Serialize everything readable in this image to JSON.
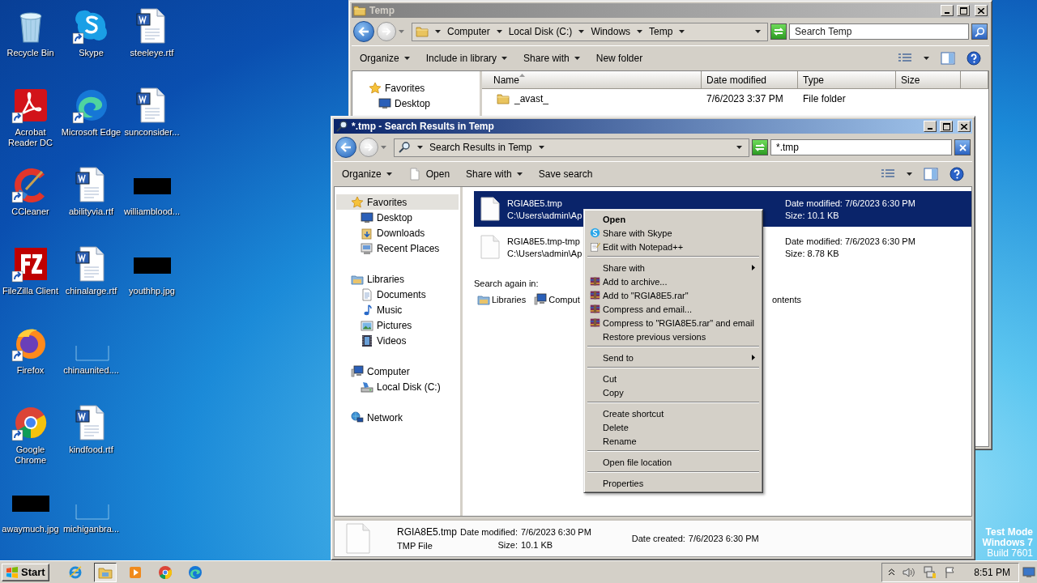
{
  "desktop": {
    "icons": [
      {
        "label": "Recycle Bin",
        "kind": "recycle",
        "shortcut": false
      },
      {
        "label": "Acrobat Reader DC",
        "kind": "acrobat",
        "shortcut": true
      },
      {
        "label": "CCleaner",
        "kind": "ccleaner",
        "shortcut": true
      },
      {
        "label": "FileZilla Client",
        "kind": "filezilla",
        "shortcut": true
      },
      {
        "label": "Firefox",
        "kind": "firefox",
        "shortcut": true
      },
      {
        "label": "Google Chrome",
        "kind": "chrome",
        "shortcut": true
      },
      {
        "label": "awaymuch.jpg",
        "kind": "dark",
        "shortcut": false
      },
      {
        "label": "Skype",
        "kind": "skype",
        "shortcut": true
      },
      {
        "label": "Microsoft Edge",
        "kind": "edge",
        "shortcut": true
      },
      {
        "label": "abilityvia.rtf",
        "kind": "word",
        "shortcut": false
      },
      {
        "label": "chinalarge.rtf",
        "kind": "word",
        "shortcut": false
      },
      {
        "label": "chinaunited....",
        "kind": "blank",
        "shortcut": false
      },
      {
        "label": "kindfood.rtf",
        "kind": "word",
        "shortcut": false
      },
      {
        "label": "michiganbra...",
        "kind": "blank",
        "shortcut": false
      },
      {
        "label": "steeleye.rtf",
        "kind": "word",
        "shortcut": false
      },
      {
        "label": "sunconsider...",
        "kind": "word",
        "shortcut": false
      },
      {
        "label": "williamblood...",
        "kind": "dark",
        "shortcut": false
      },
      {
        "label": "youthhp.jpg",
        "kind": "dark",
        "shortcut": false
      }
    ],
    "edition": [
      {
        "text": "Test Mode",
        "bold": true
      },
      {
        "text": "Windows 7",
        "bold": true
      },
      {
        "text": "Build 7601",
        "bold": false
      }
    ]
  },
  "temp_window": {
    "title": "Temp",
    "kind": "folder",
    "active": false,
    "breadcrumbs": [
      "Computer",
      "Local Disk (C:)",
      "Windows",
      "Temp"
    ],
    "search": {
      "placeholder": "Search Temp"
    },
    "toolbar": [
      {
        "label": "Organize",
        "dropdown": true
      },
      {
        "label": "Include in library",
        "dropdown": true
      },
      {
        "label": "Share with",
        "dropdown": true
      },
      {
        "label": "New folder",
        "dropdown": false
      }
    ],
    "nav": [
      {
        "label": "Favorites",
        "kind": "star",
        "selected": false,
        "children": [
          {
            "label": "Desktop",
            "kind": "desktop",
            "selected": false
          }
        ]
      }
    ],
    "columns": [
      {
        "label": "Name",
        "sorted": true
      },
      {
        "label": "Date modified",
        "sorted": false
      },
      {
        "label": "Type",
        "sorted": false
      },
      {
        "label": "Size",
        "sorted": false
      }
    ],
    "rows": [
      {
        "name": "_avast_",
        "modified": "7/6/2023 3:37 PM",
        "type": "File folder"
      }
    ]
  },
  "search_window": {
    "title": "*.tmp - Search Results in Temp",
    "kind": "search",
    "active": true,
    "breadcrumbs": [
      "Search Results in Temp"
    ],
    "search": {
      "value": "*.tmp"
    },
    "toolbar": [
      {
        "label": "Organize",
        "dropdown": true
      },
      {
        "label": "Open",
        "dropdown": false,
        "kind": "file"
      },
      {
        "label": "Share with",
        "dropdown": true
      },
      {
        "label": "Save search",
        "dropdown": false
      }
    ],
    "nav": [
      {
        "label": "Favorites",
        "kind": "star",
        "selected": true,
        "children": [
          {
            "label": "Desktop",
            "kind": "desktop",
            "selected": false
          },
          {
            "label": "Downloads",
            "kind": "downloads",
            "selected": false
          },
          {
            "label": "Recent Places",
            "kind": "recent",
            "selected": false
          }
        ]
      },
      {
        "label": "Libraries",
        "kind": "library",
        "selected": false,
        "children": [
          {
            "label": "Documents",
            "kind": "documents",
            "selected": false
          },
          {
            "label": "Music",
            "kind": "music",
            "selected": false
          },
          {
            "label": "Pictures",
            "kind": "pictures",
            "selected": false
          },
          {
            "label": "Videos",
            "kind": "videos",
            "selected": false
          }
        ]
      },
      {
        "label": "Computer",
        "kind": "computer",
        "selected": false,
        "children": [
          {
            "label": "Local Disk (C:)",
            "kind": "disk",
            "selected": false
          }
        ]
      },
      {
        "label": "Network",
        "kind": "network",
        "selected": false
      }
    ],
    "results": [
      {
        "name": "RGIA8E5.tmp",
        "path": "C:\\Users\\admin\\Ap",
        "modified": "Date modified: 7/6/2023 6:30 PM",
        "size": "Size: 10.1 KB",
        "selected": true
      },
      {
        "name": "RGIA8E5.tmp-tmp",
        "path": "C:\\Users\\admin\\Ap",
        "modified": "Date modified: 7/6/2023 6:30 PM",
        "size": "Size: 8.78 KB",
        "selected": false
      }
    ],
    "search_again": {
      "label": "Search again in:",
      "items": [
        {
          "label": "Libraries",
          "kind": "library"
        },
        {
          "label": "Comput",
          "kind": "computer"
        },
        {
          "label": "ontents"
        }
      ]
    },
    "details": {
      "name": "RGIA8E5.tmp",
      "type": "TMP File",
      "properties": [
        {
          "label": "Date modified:",
          "value": "7/6/2023 6:30 PM"
        },
        {
          "label": "Size:",
          "value": "10.1 KB"
        },
        {
          "label": "Date created:",
          "value": "7/6/2023 6:30 PM"
        }
      ]
    }
  },
  "context_menu": {
    "groups": [
      [
        {
          "label": "Open",
          "default": true,
          "submenu": false
        },
        {
          "label": "Share with Skype",
          "kind": "skype",
          "default": false,
          "submenu": false
        },
        {
          "label": "Edit with Notepad++",
          "kind": "notepad",
          "default": false,
          "submenu": false
        }
      ],
      [
        {
          "label": "Share with",
          "default": false,
          "submenu": true
        },
        {
          "label": "Add to archive...",
          "kind": "archive",
          "default": false,
          "submenu": false
        },
        {
          "label": "Add to \"RGIA8E5.rar\"",
          "kind": "archive",
          "default": false,
          "submenu": false
        },
        {
          "label": "Compress and email...",
          "kind": "archive",
          "default": false,
          "submenu": false
        },
        {
          "label": "Compress to \"RGIA8E5.rar\" and email",
          "kind": "archive",
          "default": false,
          "submenu": false
        },
        {
          "label": "Restore previous versions",
          "default": false,
          "submenu": false
        }
      ],
      [
        {
          "label": "Send to",
          "default": false,
          "submenu": true
        }
      ],
      [
        {
          "label": "Cut",
          "default": false,
          "submenu": false
        },
        {
          "label": "Copy",
          "default": false,
          "submenu": false
        }
      ],
      [
        {
          "label": "Create shortcut",
          "default": false,
          "submenu": false
        },
        {
          "label": "Delete",
          "default": false,
          "submenu": false
        },
        {
          "label": "Rename",
          "default": false,
          "submenu": false
        }
      ],
      [
        {
          "label": "Open file location",
          "default": false,
          "submenu": false
        }
      ],
      [
        {
          "label": "Properties",
          "default": false,
          "submenu": false
        }
      ]
    ]
  },
  "taskbar": {
    "start": "Start",
    "apps": [
      {
        "kind": "ie",
        "active": false
      },
      {
        "kind": "explorer",
        "active": true
      },
      {
        "kind": "media",
        "active": false
      },
      {
        "kind": "chrome",
        "active": false
      },
      {
        "kind": "edge",
        "active": false
      }
    ],
    "clock": "8:51 PM"
  }
}
